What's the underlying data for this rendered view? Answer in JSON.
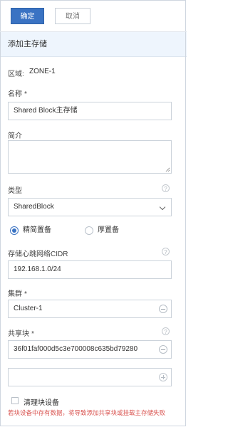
{
  "toolbar": {
    "confirm_label": "确定",
    "cancel_label": "取消"
  },
  "section": {
    "title": "添加主存储"
  },
  "zone": {
    "label": "区域:",
    "value": "ZONE-1"
  },
  "name": {
    "label": "名称",
    "required": "*",
    "value": "Shared Block主存储"
  },
  "description": {
    "label": "简介",
    "value": ""
  },
  "type": {
    "label": "类型",
    "help": "?",
    "value": "SharedBlock"
  },
  "provisioning": {
    "options": [
      "精简置备",
      "厚置备"
    ],
    "selected": "精简置备"
  },
  "network_cidr": {
    "label": "存储心跳网络CIDR",
    "help": "?",
    "value": "192.168.1.0/24"
  },
  "cluster": {
    "label": "集群",
    "required": "*",
    "value": "Cluster-1"
  },
  "shared_block": {
    "label": "共享块",
    "required": "*",
    "help": "?",
    "value": "36f01faf000d5c3e700008c635bd79280",
    "empty_value": ""
  },
  "clear_block": {
    "label": "清理块设备",
    "checked": false
  },
  "warning": {
    "text": "若块设备中存有数据，将导致添加共享块或挂载主存储失败"
  },
  "colors": {
    "primary": "#3a73c3",
    "warning": "#d9534f",
    "section_bg": "#eef5fd"
  }
}
